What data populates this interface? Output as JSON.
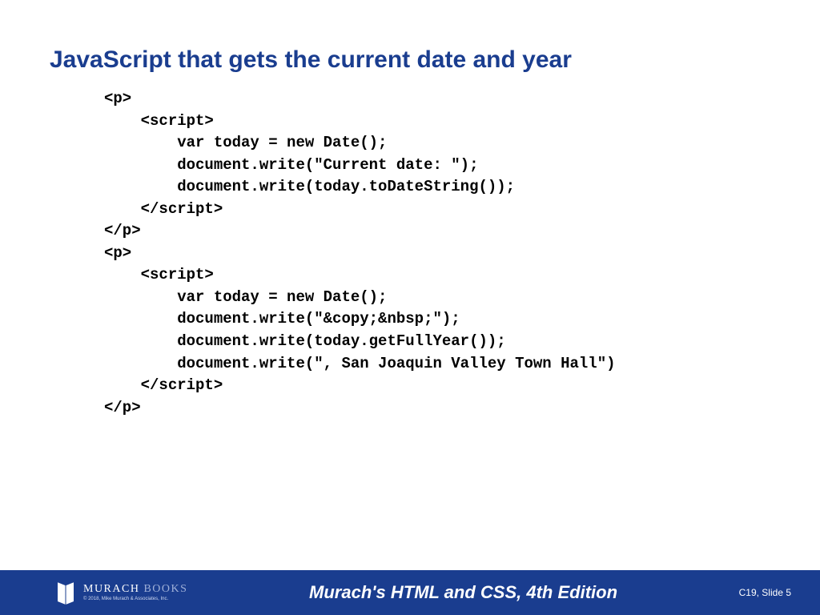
{
  "title": "JavaScript that gets the current date and year",
  "code": {
    "lines": [
      "<p>",
      "    <script>",
      "        var today = new Date();",
      "        document.write(\"Current date: \");",
      "        document.write(today.toDateString());",
      "    </script>",
      "</p>",
      "<p>",
      "    <script>",
      "        var today = new Date();",
      "        document.write(\"&copy;&nbsp;\");",
      "        document.write(today.getFullYear());",
      "        document.write(\", San Joaquin Valley Town Hall\")",
      "    </script>",
      "</p>"
    ]
  },
  "footer": {
    "logo_brand": "MURACH",
    "logo_brand_suffix": " BOOKS",
    "copyright": "© 2018, Mike Murach & Associates, Inc.",
    "book_title": "Murach's HTML and CSS, 4th Edition",
    "slide_ref": "C19, Slide 5"
  }
}
